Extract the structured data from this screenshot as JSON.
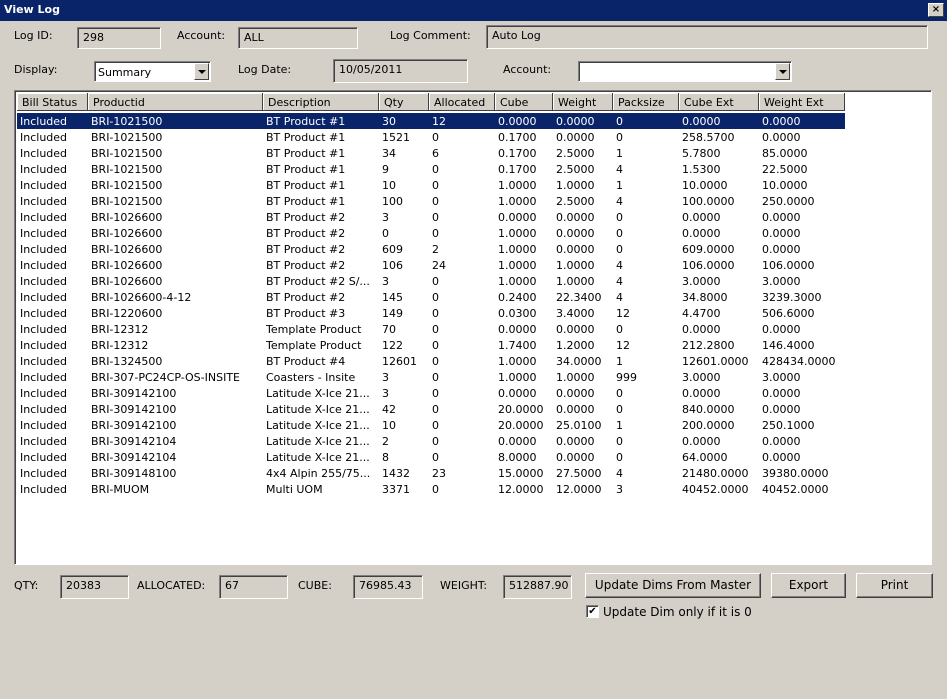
{
  "window": {
    "title": "View Log",
    "close_glyph": "×"
  },
  "header": {
    "log_id_label": "Log ID:",
    "log_id_value": "298",
    "account_label": "Account:",
    "account_value": "ALL",
    "log_comment_label": "Log Comment:",
    "log_comment_value": "Auto Log",
    "display_label": "Display:",
    "display_value": "Summary",
    "log_date_label": "Log Date:",
    "log_date_value": "10/05/2011",
    "account2_label": "Account:",
    "account2_value": ""
  },
  "grid": {
    "columns": [
      "Bill Status",
      "Productid",
      "Description",
      "Qty",
      "Allocated",
      "Cube",
      "Weight",
      "Packsize",
      "Cube Ext",
      "Weight Ext"
    ],
    "rows": [
      [
        "Included",
        "BRI-1021500",
        "BT Product #1",
        "30",
        "12",
        "0.0000",
        "0.0000",
        "0",
        "0.0000",
        "0.0000"
      ],
      [
        "Included",
        "BRI-1021500",
        "BT Product #1",
        "1521",
        "0",
        "0.1700",
        "0.0000",
        "0",
        "258.5700",
        "0.0000"
      ],
      [
        "Included",
        "BRI-1021500",
        "BT Product #1",
        "34",
        "6",
        "0.1700",
        "2.5000",
        "1",
        "5.7800",
        "85.0000"
      ],
      [
        "Included",
        "BRI-1021500",
        "BT Product #1",
        "9",
        "0",
        "0.1700",
        "2.5000",
        "4",
        "1.5300",
        "22.5000"
      ],
      [
        "Included",
        "BRI-1021500",
        "BT Product #1",
        "10",
        "0",
        "1.0000",
        "1.0000",
        "1",
        "10.0000",
        "10.0000"
      ],
      [
        "Included",
        "BRI-1021500",
        "BT Product #1",
        "100",
        "0",
        "1.0000",
        "2.5000",
        "4",
        "100.0000",
        "250.0000"
      ],
      [
        "Included",
        "BRI-1026600",
        "BT Product #2",
        "3",
        "0",
        "0.0000",
        "0.0000",
        "0",
        "0.0000",
        "0.0000"
      ],
      [
        "Included",
        "BRI-1026600",
        "BT Product #2",
        "0",
        "0",
        "1.0000",
        "0.0000",
        "0",
        "0.0000",
        "0.0000"
      ],
      [
        "Included",
        "BRI-1026600",
        "BT Product #2",
        "609",
        "2",
        "1.0000",
        "0.0000",
        "0",
        "609.0000",
        "0.0000"
      ],
      [
        "Included",
        "BRI-1026600",
        "BT Product #2",
        "106",
        "24",
        "1.0000",
        "1.0000",
        "4",
        "106.0000",
        "106.0000"
      ],
      [
        "Included",
        "BRI-1026600",
        "BT Product #2 S/...",
        "3",
        "0",
        "1.0000",
        "1.0000",
        "4",
        "3.0000",
        "3.0000"
      ],
      [
        "Included",
        "BRI-1026600-4-12",
        "BT Product #2",
        "145",
        "0",
        "0.2400",
        "22.3400",
        "4",
        "34.8000",
        "3239.3000"
      ],
      [
        "Included",
        "BRI-1220600",
        "BT Product #3",
        "149",
        "0",
        "0.0300",
        "3.4000",
        "12",
        "4.4700",
        "506.6000"
      ],
      [
        "Included",
        "BRI-12312",
        "Template Product",
        "70",
        "0",
        "0.0000",
        "0.0000",
        "0",
        "0.0000",
        "0.0000"
      ],
      [
        "Included",
        "BRI-12312",
        "Template Product",
        "122",
        "0",
        "1.7400",
        "1.2000",
        "12",
        "212.2800",
        "146.4000"
      ],
      [
        "Included",
        "BRI-1324500",
        "BT Product #4",
        "12601",
        "0",
        "1.0000",
        "34.0000",
        "1",
        "12601.0000",
        "428434.0000"
      ],
      [
        "Included",
        "BRI-307-PC24CP-OS-INSITE",
        "Coasters - Insite",
        "3",
        "0",
        "1.0000",
        "1.0000",
        "999",
        "3.0000",
        "3.0000"
      ],
      [
        "Included",
        "BRI-309142100",
        "Latitude X-Ice 21...",
        "3",
        "0",
        "0.0000",
        "0.0000",
        "0",
        "0.0000",
        "0.0000"
      ],
      [
        "Included",
        "BRI-309142100",
        "Latitude X-Ice 21...",
        "42",
        "0",
        "20.0000",
        "0.0000",
        "0",
        "840.0000",
        "0.0000"
      ],
      [
        "Included",
        "BRI-309142100",
        "Latitude X-Ice 21...",
        "10",
        "0",
        "20.0000",
        "25.0100",
        "1",
        "200.0000",
        "250.1000"
      ],
      [
        "Included",
        "BRI-309142104",
        "Latitude X-Ice 21...",
        "2",
        "0",
        "0.0000",
        "0.0000",
        "0",
        "0.0000",
        "0.0000"
      ],
      [
        "Included",
        "BRI-309142104",
        "Latitude X-Ice 21...",
        "8",
        "0",
        "8.0000",
        "0.0000",
        "0",
        "64.0000",
        "0.0000"
      ],
      [
        "Included",
        "BRI-309148100",
        "4x4 Alpin 255/75...",
        "1432",
        "23",
        "15.0000",
        "27.5000",
        "4",
        "21480.0000",
        "39380.0000"
      ],
      [
        "Included",
        "BRI-MUOM",
        "Multi UOM",
        "3371",
        "0",
        "12.0000",
        "12.0000",
        "3",
        "40452.0000",
        "40452.0000"
      ]
    ]
  },
  "footer": {
    "qty_label": "QTY:",
    "qty_value": "20383",
    "allocated_label": "ALLOCATED:",
    "allocated_value": "67",
    "cube_label": "CUBE:",
    "cube_value": "76985.43",
    "weight_label": "WEIGHT:",
    "weight_value": "512887.90",
    "update_dims_button": "Update Dims From Master",
    "export_button": "Export",
    "print_button": "Print",
    "update_dim_checkbox_label": "Update Dim only if it is 0",
    "update_dim_checked": true
  }
}
